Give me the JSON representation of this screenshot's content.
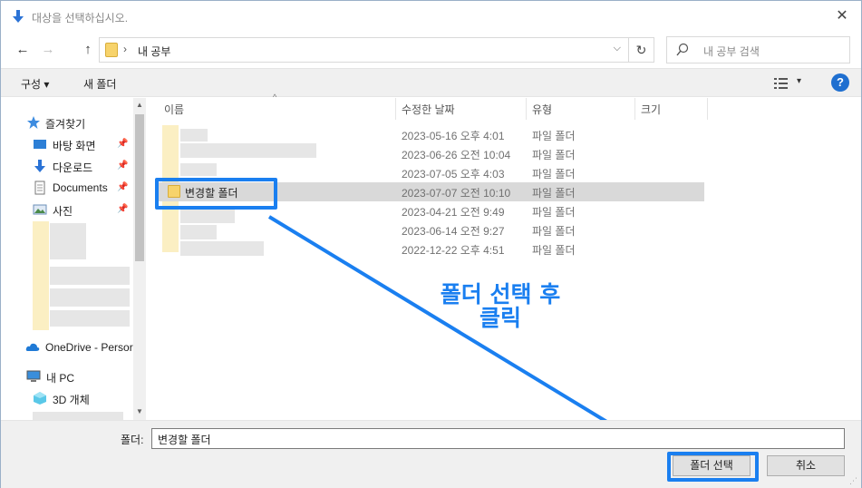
{
  "window": {
    "title": "대상을 선택하십시오.",
    "close_symbol": "✕"
  },
  "nav": {
    "back": "←",
    "forward": "→",
    "up": "↑",
    "refresh": "↻"
  },
  "address": {
    "separator": "›",
    "path": "내 공부",
    "dropdown": "⌵"
  },
  "search": {
    "placeholder": "내 공부 검색"
  },
  "toolbar": {
    "organize": "구성 ▾",
    "new_folder": "새 폴더",
    "view_dropdown": "▾",
    "help": "?"
  },
  "sidebar": {
    "items": [
      {
        "label": "즐겨찾기",
        "icon": "star-icon"
      },
      {
        "label": "바탕 화면",
        "icon": "desktop-icon",
        "pinned": true
      },
      {
        "label": "다운로드",
        "icon": "download-icon",
        "pinned": true
      },
      {
        "label": "Documents",
        "icon": "document-icon",
        "pinned": true
      },
      {
        "label": "사진",
        "icon": "pictures-icon",
        "pinned": true
      },
      {
        "label": "OneDrive - Persor",
        "icon": "cloud-icon"
      },
      {
        "label": "내 PC",
        "icon": "pc-icon"
      },
      {
        "label": "3D 개체",
        "icon": "cube-icon"
      }
    ]
  },
  "columns": {
    "name": "이름",
    "date": "수정한 날짜",
    "type": "유형",
    "size": "크기"
  },
  "files": [
    {
      "name": "",
      "date": "2023-05-16 오후 4:01",
      "type": "파일 폴더"
    },
    {
      "name": "",
      "date": "2023-06-26 오전 10:04",
      "type": "파일 폴더"
    },
    {
      "name": "",
      "date": "2023-07-05 오후 4:03",
      "type": "파일 폴더"
    },
    {
      "name": "변경할 폴더",
      "date": "2023-07-07 오전 10:10",
      "type": "파일 폴더",
      "selected": true
    },
    {
      "name": "",
      "date": "2023-04-21 오전 9:49",
      "type": "파일 폴더"
    },
    {
      "name": "",
      "date": "2023-06-14 오전 9:27",
      "type": "파일 폴더"
    },
    {
      "name": "",
      "date": "2022-12-22 오후 4:51",
      "type": "파일 폴더"
    }
  ],
  "annotation": {
    "line1": "폴더 선택 후",
    "line2": "클릭",
    "color": "#1a7ff0"
  },
  "bottom": {
    "folder_label": "폴더:",
    "folder_value": "변경할 폴더",
    "select_button": "폴더 선택",
    "cancel_button": "취소"
  }
}
